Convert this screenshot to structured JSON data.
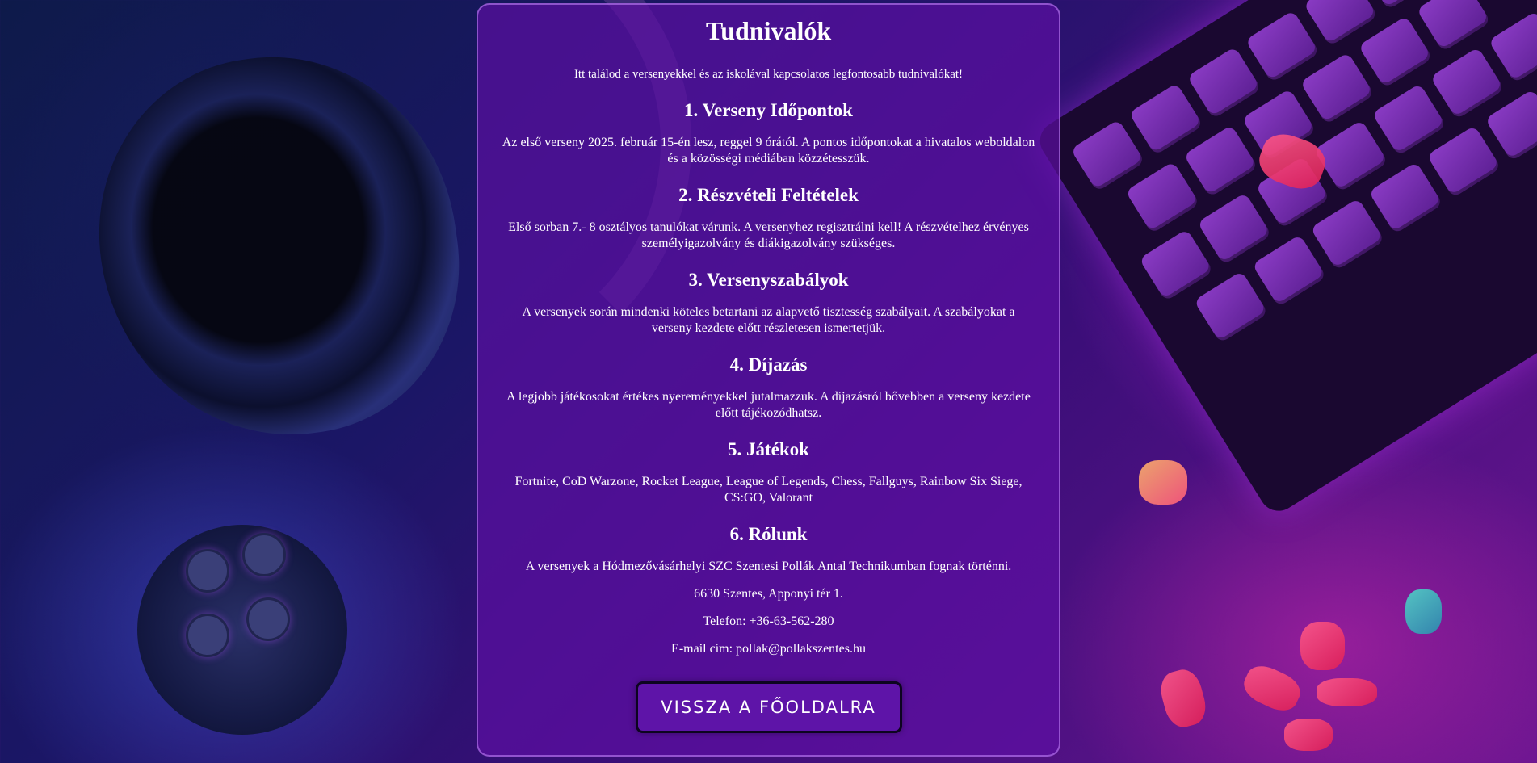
{
  "page": {
    "title": "Tudnivalók",
    "intro": "Itt találod a versenyekkel és az iskolával kapcsolatos legfontosabb tudnivalókat!"
  },
  "sections": [
    {
      "title": "1. Verseny Időpontok",
      "text": "Az első verseny 2025. február 15-én lesz, reggel 9 órától. A pontos időpontokat a hivatalos weboldalon és a közösségi médiában közzétesszük."
    },
    {
      "title": "2. Részvételi Feltételek",
      "text": "Első sorban 7.- 8 osztályos tanulókat várunk. A versenyhez regisztrálni kell! A részvételhez érvényes személyigazolvány és diákigazolvány szükséges."
    },
    {
      "title": "3. Versenyszabályok",
      "text": "A versenyek során mindenki köteles betartani az alapvető tisztesség szabályait. A szabályokat a verseny kezdete előtt részletesen ismertetjük."
    },
    {
      "title": "4. Díjazás",
      "text": "A legjobb játékosokat értékes nyereményekkel jutalmazzuk. A díjazásról bővebben a verseny kezdete előtt tájékozódhatsz."
    },
    {
      "title": "5. Játékok",
      "text": "Fortnite, CoD Warzone, Rocket League, League of Legends, Chess, Fallguys, Rainbow Six Siege, CS:GO, Valorant"
    },
    {
      "title": "6. Rólunk",
      "text": "A versenyek a Hódmezővásárhelyi SZC Szentesi Pollák Antal Technikumban fognak történni."
    }
  ],
  "contact": {
    "address": "6630 Szentes, Apponyi tér 1.",
    "phone": "Telefon: +36-63-562-280",
    "email": "E-mail cím: pollak@pollakszentes.hu"
  },
  "buttons": {
    "back_label": "VISSZA A FŐOLDALRA"
  },
  "colors": {
    "panel": "#5f0fa5",
    "button": "#5e14a8",
    "text": "#ffffff"
  }
}
